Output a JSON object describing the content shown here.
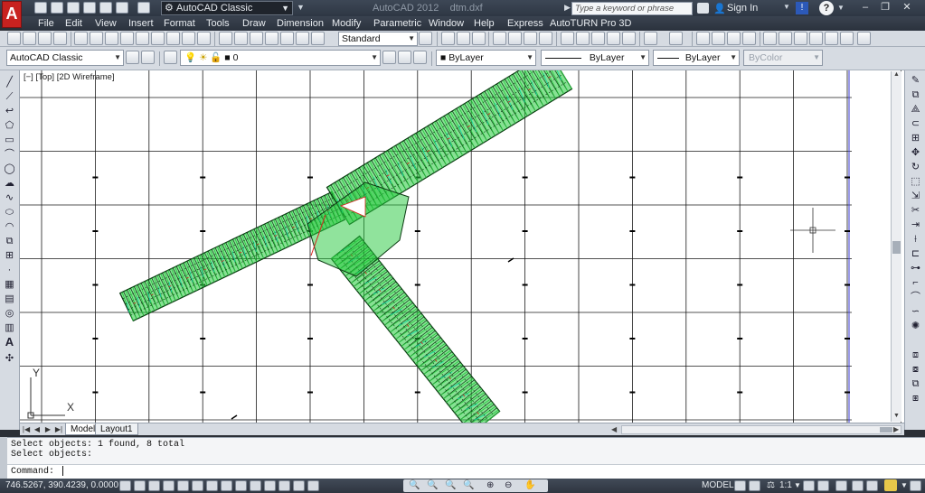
{
  "title_bar": {
    "app_name": "AutoCAD 2012",
    "file_name": "dtm.dxf",
    "logo_letter": "A",
    "workspace": "AutoCAD Classic",
    "search_placeholder": "Type a keyword or phrase",
    "sign_in": "Sign In",
    "help": "?",
    "minimize": "–",
    "restore": "❐",
    "close": "✕"
  },
  "menu": [
    "File",
    "Edit",
    "View",
    "Insert",
    "Format",
    "Tools",
    "Draw",
    "Dimension",
    "Modify",
    "Parametric",
    "Window",
    "Help",
    "Express",
    "AutoTURN Pro 3D"
  ],
  "toolbar_styles": {
    "text_style": "Standard"
  },
  "toolbar_layers": {
    "workspace": "AutoCAD Classic",
    "layer": "0",
    "color": "ByLayer",
    "linetype": "ByLayer",
    "lineweight": "ByLayer",
    "plotstyle": "ByColor"
  },
  "viewport": {
    "label": "[−] [Top] [2D Wireframe]",
    "ucs_x": "X",
    "ucs_y": "Y"
  },
  "layout_tabs": [
    "Model",
    "Layout1"
  ],
  "command": {
    "history": [
      "Select objects: 1 found, 8 total",
      "Select objects:"
    ],
    "prompt": "Command:"
  },
  "status": {
    "coordinates": "746.5267, 390.4239, 0.0000",
    "space": "MODEL",
    "annotation_scale": "1:1"
  },
  "colors": {
    "title_bg": "#2e3744",
    "toolbar_bg": "#d6dbe2",
    "mesh_green": "#22c83a",
    "mesh_dark": "#0b3a12",
    "mesh_cyan": "#19e0d0",
    "mesh_red": "#d9241c",
    "logo_red": "#c8221f"
  }
}
